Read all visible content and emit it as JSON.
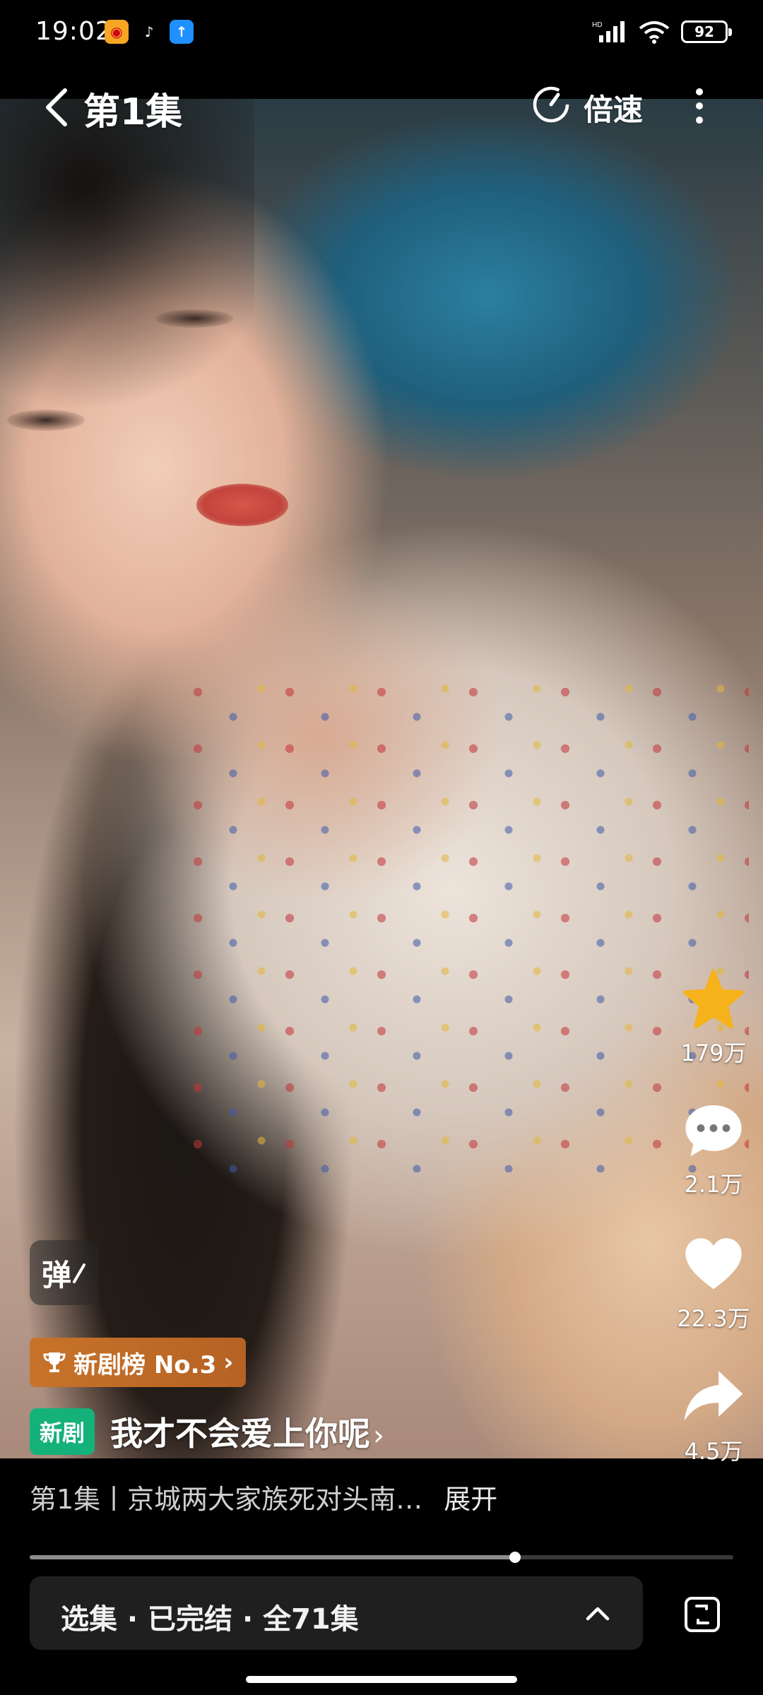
{
  "status_bar": {
    "time": "19:02",
    "app_icons": [
      "weibo-icon",
      "tiktok-icon",
      "upload-icon"
    ],
    "network": "HD",
    "battery": "92"
  },
  "top_bar": {
    "episode_title": "第1集",
    "speed_label": "倍速"
  },
  "actions": {
    "favorite_count": "179万",
    "comment_count": "2.1万",
    "like_count": "22.3万",
    "share_count": "4.5万",
    "favorite_color": "#f6b21b"
  },
  "danmu_label": "弹",
  "rank_badge": {
    "label": "新剧榜 No.3",
    "chevron": "›"
  },
  "drama": {
    "tag": "新剧",
    "title": "我才不会爱上你呢",
    "chevron": "›"
  },
  "description": {
    "text": "第1集丨京城两大家族死对头南…",
    "expand": "展开"
  },
  "playback": {
    "progress_fraction": 0.69
  },
  "episode_bar": {
    "text": "选集 · 已完结 · 全71集"
  },
  "colors": {
    "new_tag": "#14b27a",
    "rank_badge": "#c8732a"
  }
}
